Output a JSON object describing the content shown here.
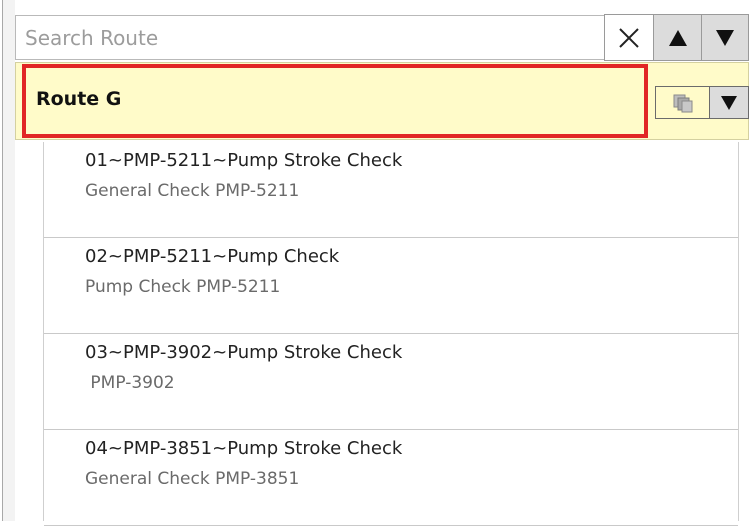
{
  "search": {
    "placeholder": "Search Route",
    "value": ""
  },
  "controls": {
    "clear_icon": "close-icon",
    "up_icon": "triangle-up-icon",
    "down_icon": "triangle-down-icon"
  },
  "route": {
    "title": "Route G",
    "copy_icon": "copy-icon",
    "menu_icon": "triangle-down-icon"
  },
  "items": [
    {
      "title": "01~PMP-5211~Pump Stroke Check",
      "subtitle": "General Check PMP-5211"
    },
    {
      "title": "02~PMP-5211~Pump Check",
      "subtitle": "Pump Check PMP-5211"
    },
    {
      "title": "03~PMP-3902~Pump Stroke Check",
      "subtitle": " PMP-3902"
    },
    {
      "title": "04~PMP-3851~Pump Stroke Check",
      "subtitle": "General Check PMP-3851"
    }
  ],
  "colors": {
    "route_background": "#fffbc9",
    "highlight_border": "#e12626",
    "button_gray": "#dcdcdc"
  }
}
